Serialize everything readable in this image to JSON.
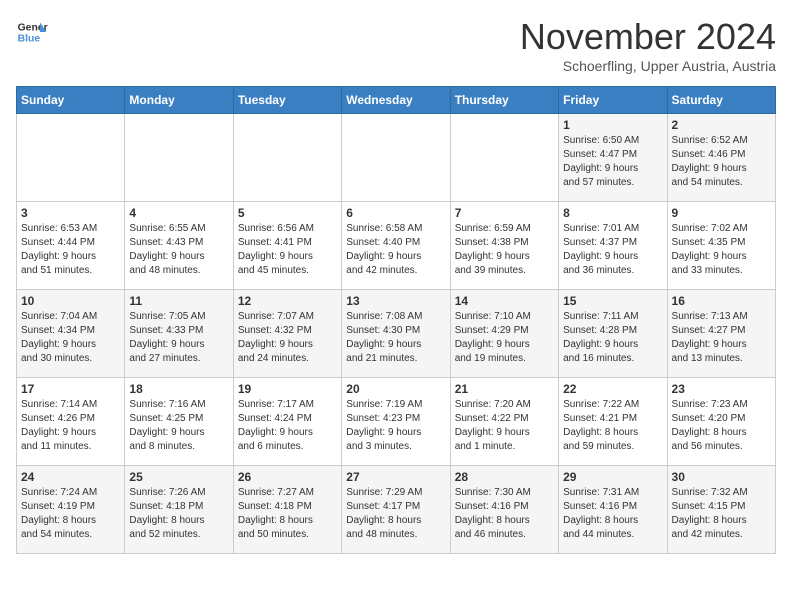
{
  "header": {
    "logo_line1": "General",
    "logo_line2": "Blue",
    "month": "November 2024",
    "location": "Schoerfling, Upper Austria, Austria"
  },
  "days_of_week": [
    "Sunday",
    "Monday",
    "Tuesday",
    "Wednesday",
    "Thursday",
    "Friday",
    "Saturday"
  ],
  "weeks": [
    [
      {
        "day": "",
        "info": ""
      },
      {
        "day": "",
        "info": ""
      },
      {
        "day": "",
        "info": ""
      },
      {
        "day": "",
        "info": ""
      },
      {
        "day": "",
        "info": ""
      },
      {
        "day": "1",
        "info": "Sunrise: 6:50 AM\nSunset: 4:47 PM\nDaylight: 9 hours\nand 57 minutes."
      },
      {
        "day": "2",
        "info": "Sunrise: 6:52 AM\nSunset: 4:46 PM\nDaylight: 9 hours\nand 54 minutes."
      }
    ],
    [
      {
        "day": "3",
        "info": "Sunrise: 6:53 AM\nSunset: 4:44 PM\nDaylight: 9 hours\nand 51 minutes."
      },
      {
        "day": "4",
        "info": "Sunrise: 6:55 AM\nSunset: 4:43 PM\nDaylight: 9 hours\nand 48 minutes."
      },
      {
        "day": "5",
        "info": "Sunrise: 6:56 AM\nSunset: 4:41 PM\nDaylight: 9 hours\nand 45 minutes."
      },
      {
        "day": "6",
        "info": "Sunrise: 6:58 AM\nSunset: 4:40 PM\nDaylight: 9 hours\nand 42 minutes."
      },
      {
        "day": "7",
        "info": "Sunrise: 6:59 AM\nSunset: 4:38 PM\nDaylight: 9 hours\nand 39 minutes."
      },
      {
        "day": "8",
        "info": "Sunrise: 7:01 AM\nSunset: 4:37 PM\nDaylight: 9 hours\nand 36 minutes."
      },
      {
        "day": "9",
        "info": "Sunrise: 7:02 AM\nSunset: 4:35 PM\nDaylight: 9 hours\nand 33 minutes."
      }
    ],
    [
      {
        "day": "10",
        "info": "Sunrise: 7:04 AM\nSunset: 4:34 PM\nDaylight: 9 hours\nand 30 minutes."
      },
      {
        "day": "11",
        "info": "Sunrise: 7:05 AM\nSunset: 4:33 PM\nDaylight: 9 hours\nand 27 minutes."
      },
      {
        "day": "12",
        "info": "Sunrise: 7:07 AM\nSunset: 4:32 PM\nDaylight: 9 hours\nand 24 minutes."
      },
      {
        "day": "13",
        "info": "Sunrise: 7:08 AM\nSunset: 4:30 PM\nDaylight: 9 hours\nand 21 minutes."
      },
      {
        "day": "14",
        "info": "Sunrise: 7:10 AM\nSunset: 4:29 PM\nDaylight: 9 hours\nand 19 minutes."
      },
      {
        "day": "15",
        "info": "Sunrise: 7:11 AM\nSunset: 4:28 PM\nDaylight: 9 hours\nand 16 minutes."
      },
      {
        "day": "16",
        "info": "Sunrise: 7:13 AM\nSunset: 4:27 PM\nDaylight: 9 hours\nand 13 minutes."
      }
    ],
    [
      {
        "day": "17",
        "info": "Sunrise: 7:14 AM\nSunset: 4:26 PM\nDaylight: 9 hours\nand 11 minutes."
      },
      {
        "day": "18",
        "info": "Sunrise: 7:16 AM\nSunset: 4:25 PM\nDaylight: 9 hours\nand 8 minutes."
      },
      {
        "day": "19",
        "info": "Sunrise: 7:17 AM\nSunset: 4:24 PM\nDaylight: 9 hours\nand 6 minutes."
      },
      {
        "day": "20",
        "info": "Sunrise: 7:19 AM\nSunset: 4:23 PM\nDaylight: 9 hours\nand 3 minutes."
      },
      {
        "day": "21",
        "info": "Sunrise: 7:20 AM\nSunset: 4:22 PM\nDaylight: 9 hours\nand 1 minute."
      },
      {
        "day": "22",
        "info": "Sunrise: 7:22 AM\nSunset: 4:21 PM\nDaylight: 8 hours\nand 59 minutes."
      },
      {
        "day": "23",
        "info": "Sunrise: 7:23 AM\nSunset: 4:20 PM\nDaylight: 8 hours\nand 56 minutes."
      }
    ],
    [
      {
        "day": "24",
        "info": "Sunrise: 7:24 AM\nSunset: 4:19 PM\nDaylight: 8 hours\nand 54 minutes."
      },
      {
        "day": "25",
        "info": "Sunrise: 7:26 AM\nSunset: 4:18 PM\nDaylight: 8 hours\nand 52 minutes."
      },
      {
        "day": "26",
        "info": "Sunrise: 7:27 AM\nSunset: 4:18 PM\nDaylight: 8 hours\nand 50 minutes."
      },
      {
        "day": "27",
        "info": "Sunrise: 7:29 AM\nSunset: 4:17 PM\nDaylight: 8 hours\nand 48 minutes."
      },
      {
        "day": "28",
        "info": "Sunrise: 7:30 AM\nSunset: 4:16 PM\nDaylight: 8 hours\nand 46 minutes."
      },
      {
        "day": "29",
        "info": "Sunrise: 7:31 AM\nSunset: 4:16 PM\nDaylight: 8 hours\nand 44 minutes."
      },
      {
        "day": "30",
        "info": "Sunrise: 7:32 AM\nSunset: 4:15 PM\nDaylight: 8 hours\nand 42 minutes."
      }
    ]
  ]
}
